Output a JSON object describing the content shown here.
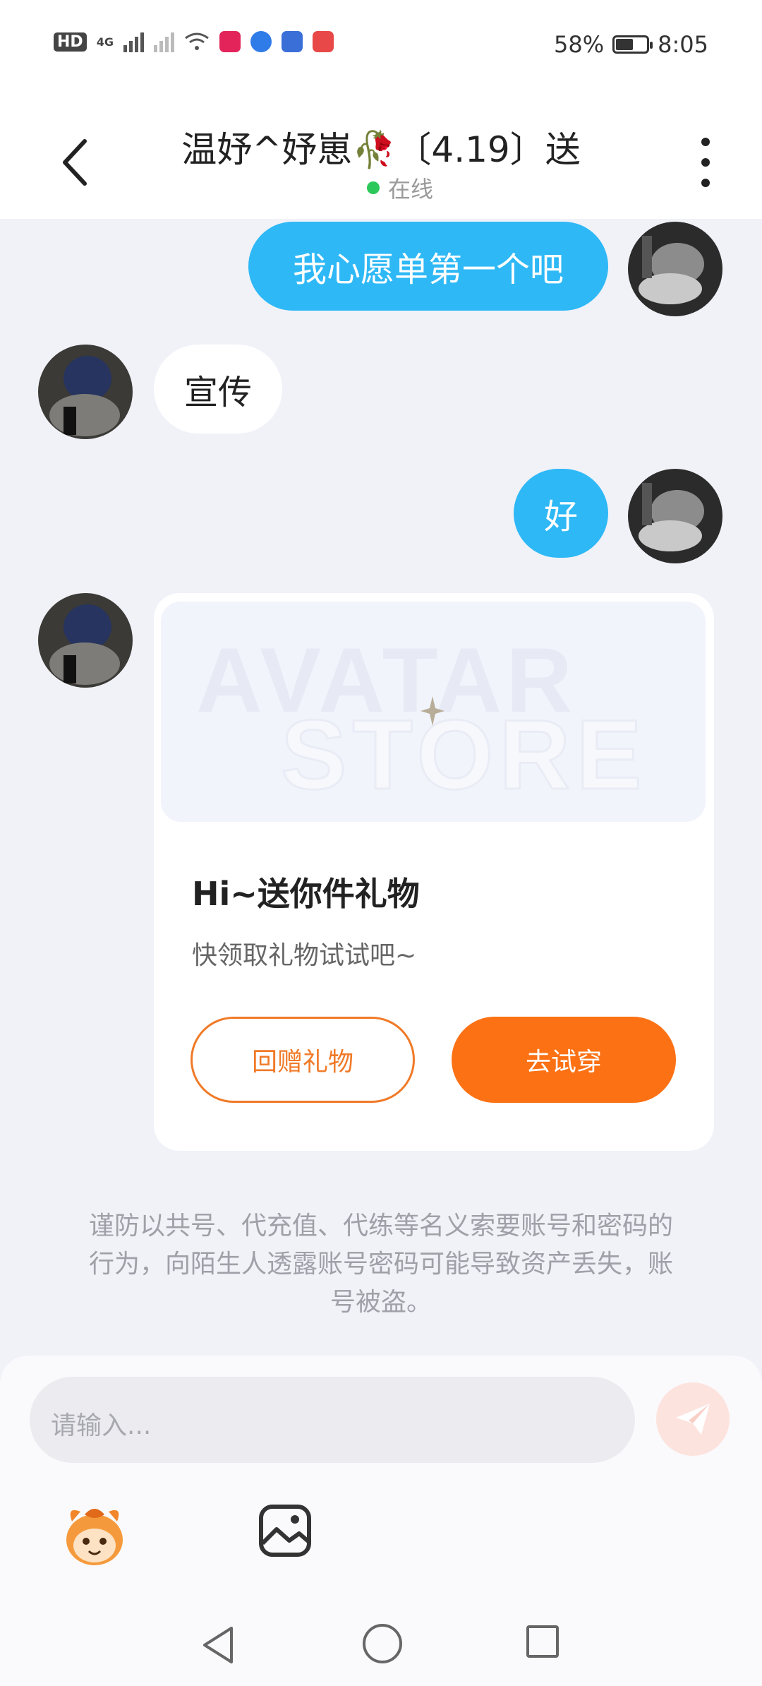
{
  "status_bar": {
    "network_badge": "HD",
    "network_type": "4G",
    "battery_percent": "58%",
    "battery_level": 0.58,
    "time": "8:05"
  },
  "header": {
    "title": "温妤^妤崽🥀〔4.19〕送",
    "status": "在线"
  },
  "messages": [
    {
      "side": "right",
      "text": "我心愿单第一个吧"
    },
    {
      "side": "left",
      "text": "宣传"
    },
    {
      "side": "right",
      "text": "好"
    }
  ],
  "gift_card": {
    "banner_watermark_line1": "AVATAR",
    "banner_watermark_line2": "STORE",
    "title": "Hi~送你件礼物",
    "subtitle": "快领取礼物试试吧~",
    "return_gift_label": "回赠礼物",
    "try_on_label": "去试穿"
  },
  "notice": "谨防以共号、代充值、代练等名义索要账号和密码的行为，向陌生人透露账号密码可能导致资产丢失，账号被盗。",
  "composer": {
    "placeholder": "请输入..."
  },
  "icons": {
    "back": "chevron-left-icon",
    "more": "more-vertical-icon",
    "send": "paper-plane-icon",
    "emoji": "mascot-emoji-icon",
    "image": "image-icon"
  },
  "colors": {
    "bubble_self": "#2eb8f6",
    "accent_orange": "#fb7114",
    "online": "#2cc85a"
  }
}
